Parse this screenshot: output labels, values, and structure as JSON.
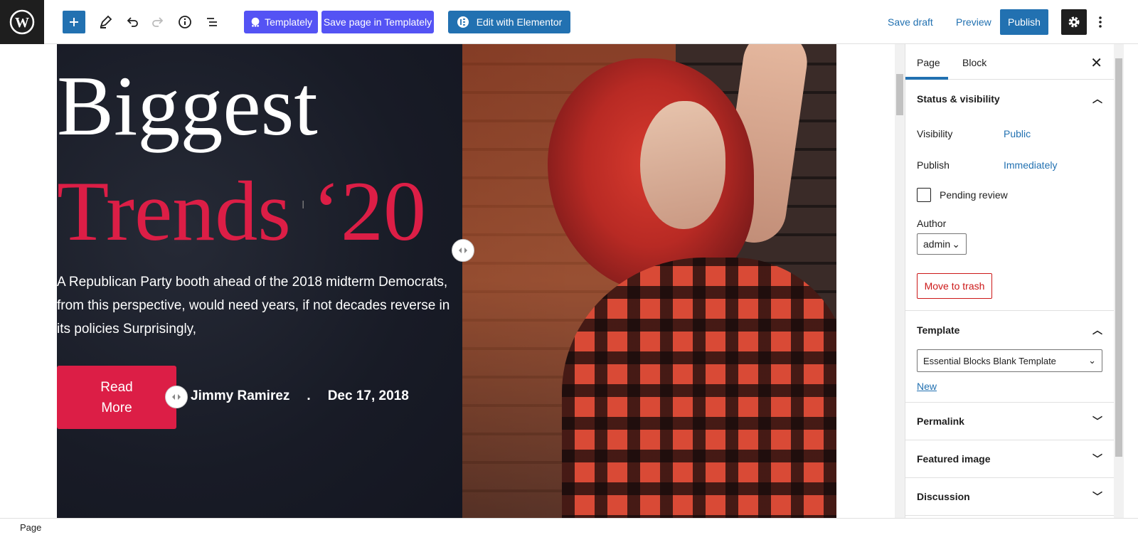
{
  "toolbar": {
    "templately_label": "Templately",
    "save_templately_label": "Save page in Templately",
    "elementor_label": "Edit with Elementor",
    "save_draft_label": "Save draft",
    "preview_label": "Preview",
    "publish_label": "Publish"
  },
  "hero": {
    "headline_line1": "Biggest",
    "headline_line2": "Trends ‘20",
    "lede": "A Republican Party booth ahead of the 2018 midterm Democrats, from this perspective, would need years, if not decades reverse in its policies Surprisingly,",
    "button_label": "Read More",
    "author": "Jimmy Ramirez",
    "separator": ".",
    "date": "Dec 17, 2018"
  },
  "sidebar": {
    "tabs": [
      "Page",
      "Block"
    ],
    "status": {
      "title": "Status & visibility",
      "visibility_label": "Visibility",
      "visibility_value": "Public",
      "publish_label": "Publish",
      "publish_value": "Immediately",
      "pending_review_label": "Pending review",
      "author_label": "Author",
      "author_value": "admin",
      "trash_label": "Move to trash"
    },
    "template": {
      "title": "Template",
      "selected": "Essential Blocks Blank Template",
      "new_link": "New"
    },
    "permalink_title": "Permalink",
    "featured_title": "Featured image",
    "discussion_title": "Discussion"
  },
  "statusbar": {
    "label": "Page"
  },
  "colors": {
    "accent": "#2271b1",
    "templately": "#5453f4",
    "hero_red": "#dc1e46",
    "trash": "#cc1818"
  }
}
